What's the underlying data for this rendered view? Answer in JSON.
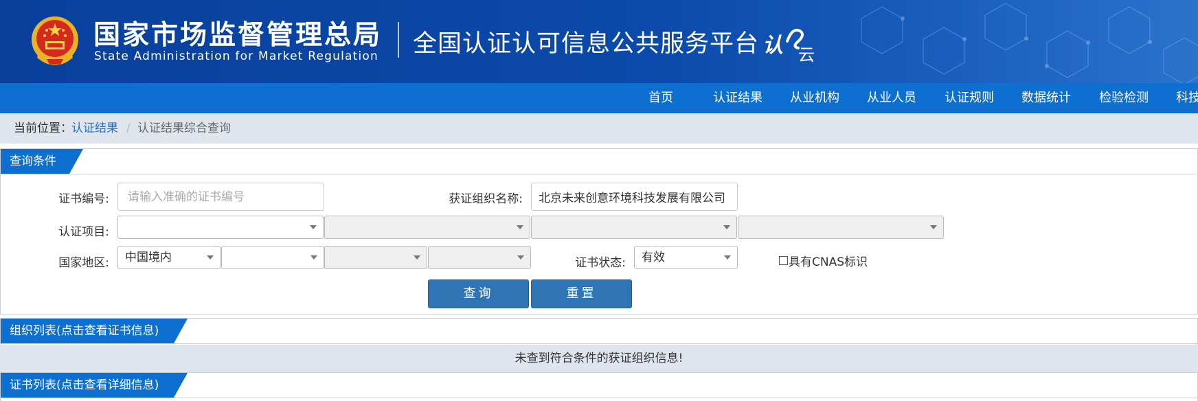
{
  "header": {
    "org_name_cn": "国家市场监督管理总局",
    "org_name_en": "State Administration  for  Market Regulation",
    "platform_title": "全国认证认可信息公共服务平台",
    "brand_mark": "认云"
  },
  "nav": {
    "items": [
      "首页",
      "认证结果",
      "从业机构",
      "从业人员",
      "认证规则",
      "数据统计",
      "检验检测",
      "科技"
    ]
  },
  "breadcrumb": {
    "prefix": "当前位置：",
    "link": "认证结果",
    "separator": "/",
    "current": "认证结果综合查询"
  },
  "query_panel": {
    "title": "查询条件",
    "cert_no_label": "证书编号:",
    "cert_no_placeholder": "请输入准确的证书编号",
    "org_name_label": "获证组织名称:",
    "org_name_value": "北京未来创意环境科技发展有限公司",
    "project_label": "认证项目:",
    "project_selects": [
      "",
      "",
      "",
      ""
    ],
    "region_label": "国家地区:",
    "region_selects": [
      "中国境内",
      "",
      "",
      ""
    ],
    "status_label": "证书状态:",
    "status_value": "有效",
    "cnas_label": "具有CNAS标识",
    "cnas_checked": false,
    "search_button": "查询",
    "reset_button": "重置"
  },
  "org_panel": {
    "title": "组织列表(点击查看证书信息)",
    "empty_message": "未查到符合条件的获证组织信息!"
  },
  "cert_panel": {
    "title": "证书列表(点击查看详细信息)"
  },
  "colors": {
    "banner_blue": "#0b4aaa",
    "nav_blue": "#0d6fd0",
    "button_blue": "#2f75b5",
    "link_blue": "#2a6fc0",
    "breadcrumb_bg": "#dfe5ec"
  }
}
